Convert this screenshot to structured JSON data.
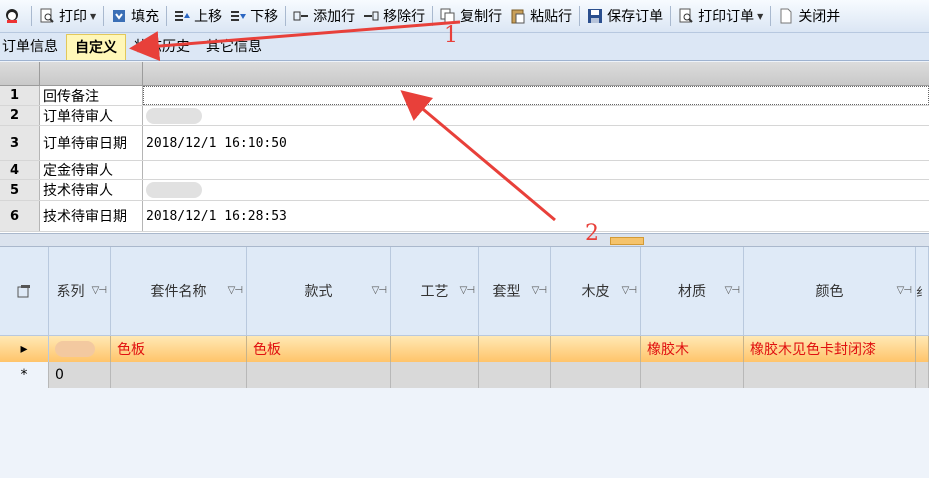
{
  "toolbar": {
    "items": [
      {
        "label": "",
        "icon": "qq-icon"
      },
      {
        "label": "打印",
        "icon": "print-preview-icon",
        "dropdown": true
      },
      {
        "label": "填充",
        "icon": "fill-icon"
      },
      {
        "label": "上移",
        "icon": "move-up-icon"
      },
      {
        "label": "下移",
        "icon": "move-down-icon"
      },
      {
        "label": "添加行",
        "icon": "add-row-icon"
      },
      {
        "label": "移除行",
        "icon": "remove-row-icon"
      },
      {
        "label": "复制行",
        "icon": "copy-row-icon"
      },
      {
        "label": "粘贴行",
        "icon": "paste-row-icon"
      },
      {
        "label": "保存订单",
        "icon": "save-icon"
      },
      {
        "label": "打印订单",
        "icon": "print-order-icon",
        "dropdown": true
      },
      {
        "label": "关闭并",
        "icon": "close-doc-icon"
      }
    ]
  },
  "tabs": [
    {
      "label": "订单信息",
      "active": false
    },
    {
      "label": "自定义",
      "active": true
    },
    {
      "label": "状态历史",
      "active": false
    },
    {
      "label": "其它信息",
      "active": false
    }
  ],
  "property_grid": {
    "rows": [
      {
        "num": "1",
        "label": "回传备注",
        "value": ""
      },
      {
        "num": "2",
        "label": "订单待审人",
        "value": ""
      },
      {
        "num": "3",
        "label": "订单待审日期",
        "value": "2018/12/1 16:10:50"
      },
      {
        "num": "4",
        "label": "定金待审人",
        "value": ""
      },
      {
        "num": "5",
        "label": "技术待审人",
        "value": ""
      },
      {
        "num": "6",
        "label": "技术待审日期",
        "value": "2018/12/1 16:28:53"
      }
    ]
  },
  "data_grid": {
    "columns": [
      "系列",
      "套件名称",
      "款式",
      "工艺",
      "套型",
      "木皮",
      "材质",
      "颜色",
      "纟"
    ],
    "selected_row": [
      "",
      "色板",
      "色板",
      "",
      "",
      "",
      "橡胶木",
      "橡胶木见色卡封闭漆",
      ""
    ],
    "new_row": [
      "0",
      "",
      "",
      "",
      "",
      "",
      "",
      "",
      ""
    ],
    "new_row_marker": "*",
    "selected_row_marker": "▸"
  },
  "annotations": {
    "label1": "1",
    "label2": "2",
    "color": "#e8403a"
  },
  "colors": {
    "selection_text": "#e01010",
    "tab_active_bg": "#fff7b8",
    "row_highlight": "#ffc46a"
  }
}
